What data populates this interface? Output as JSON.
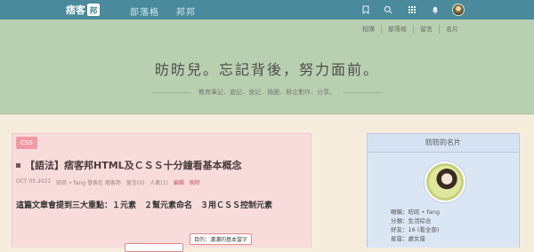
{
  "topbar": {
    "logo_text": "痞客",
    "logo_badge": "邦",
    "nav": [
      "部落格",
      "邦邦"
    ],
    "icons": [
      "bookmark-icon",
      "search-icon",
      "grid-icon",
      "bell-icon",
      "user-avatar"
    ]
  },
  "header": {
    "nav": [
      "相簿",
      "部落格",
      "留言",
      "名片"
    ],
    "title": "昉昉兒。忘記背後，努力面前。",
    "description": "教育筆記．遊記．食記．插圖．掰企劃作．分享。"
  },
  "post": {
    "category": "CSS",
    "title": "【語法】痞客邦HTML及ＣＳＳ十分鐘看基本概念",
    "meta": {
      "date": "OCT 05 2021",
      "author": "昉昉 • fang 發表在 痞客邦",
      "comments": "留言(0)",
      "views": "人氣(1)",
      "edit": "編輯",
      "delete": "刪除"
    },
    "intro": "這篇文章會提到三大重點：１元素　２幫元素命名　３用ＣＳＳ控制元素",
    "diagram": {
      "box2": "目的：濃濃的基本當字"
    }
  },
  "sidebar": {
    "title": "昉昉的名片",
    "info": [
      "暱稱：昉昉 • fang",
      "分類：生活綜合",
      "好友：16 (看全部)",
      "星座：處女座"
    ]
  },
  "colors": {
    "topbar": "#4a8a9c",
    "header": "#b9d0b0",
    "page_bg": "#f6ecdc",
    "post_card": "#f8dcdc",
    "badge": "#f19aa4",
    "side_card": "#dbe6f4"
  }
}
